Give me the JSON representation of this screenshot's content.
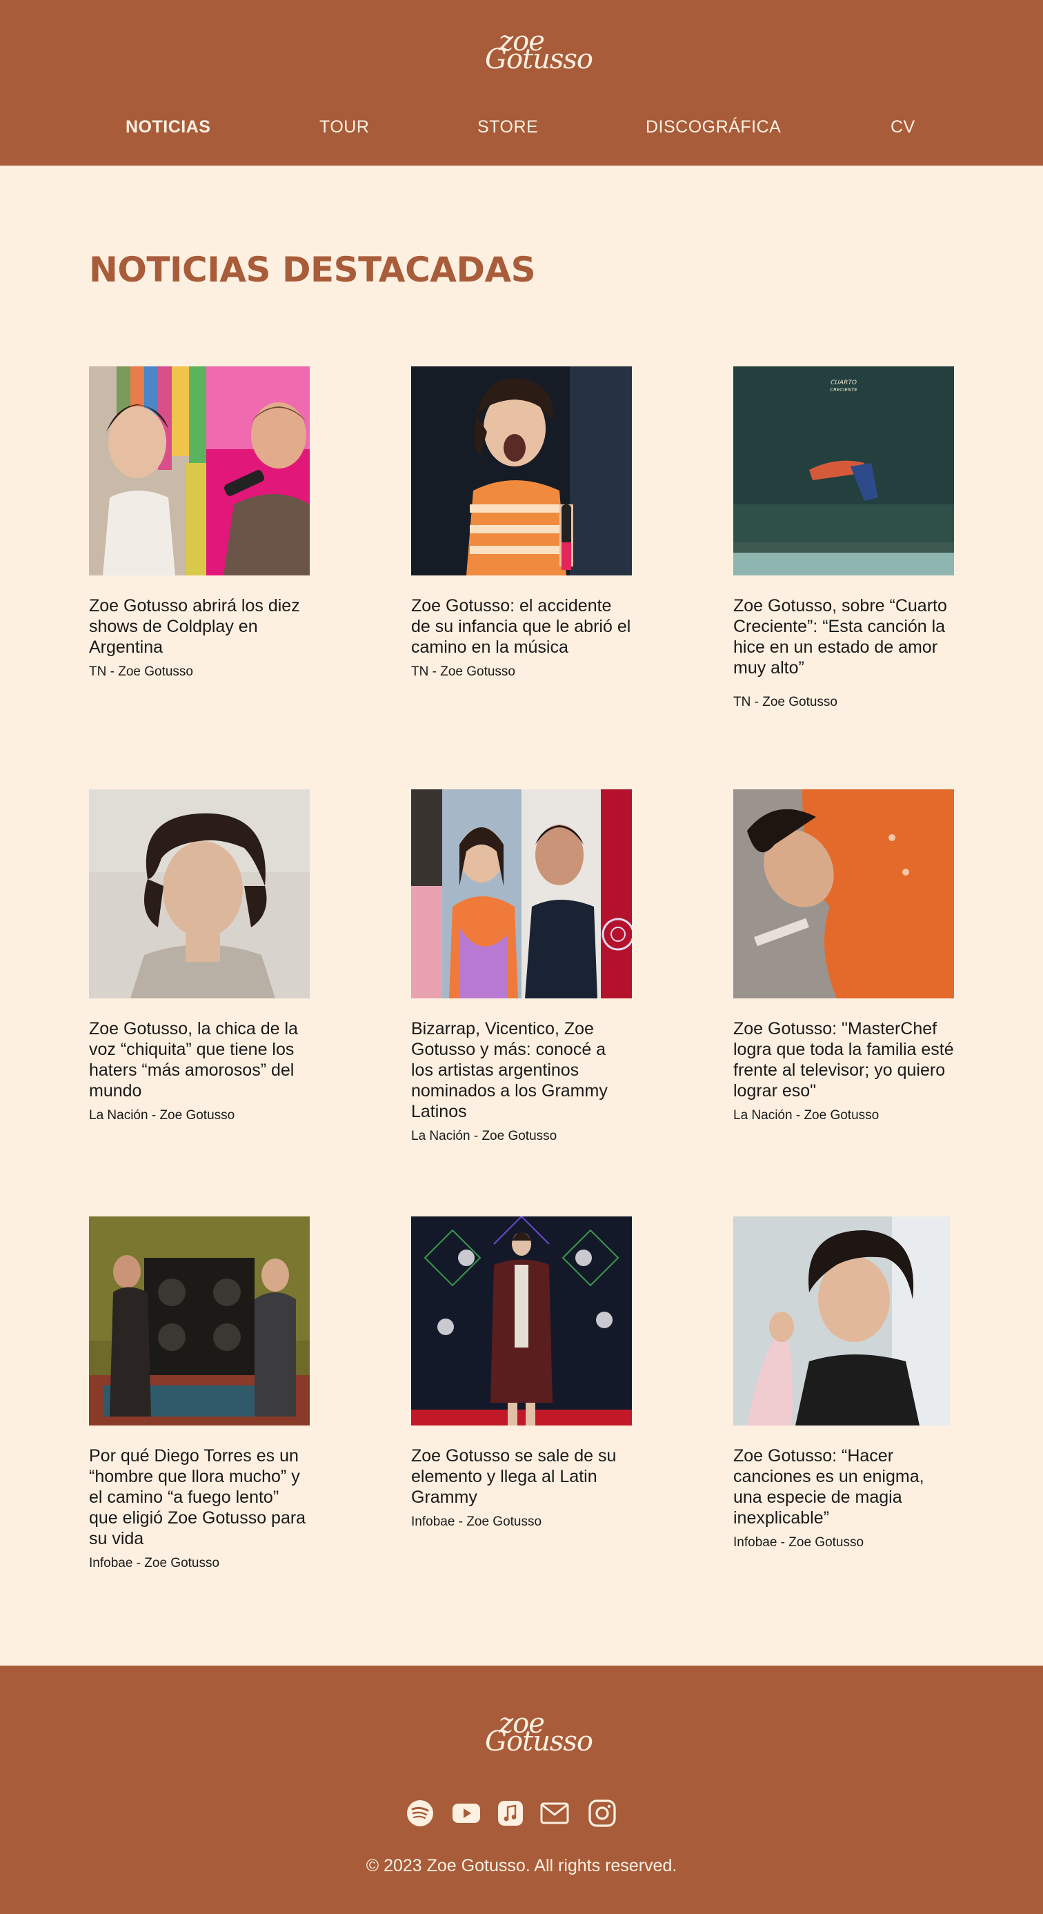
{
  "brand": {
    "logo_line1": "zoe",
    "logo_line2": "Gotusso",
    "header_color": "#a85c3a",
    "background_color": "#fdf0e1"
  },
  "nav": {
    "items": [
      {
        "label": "NOTICIAS",
        "active": true
      },
      {
        "label": "TOUR",
        "active": false
      },
      {
        "label": "STORE",
        "active": false
      },
      {
        "label": "DISCOGRÁFICA",
        "active": false
      },
      {
        "label": "CV",
        "active": false
      }
    ]
  },
  "main": {
    "title": "NOTICIAS DESTACADAS",
    "articles": [
      {
        "title": "Zoe Gotusso abrirá los diez shows de Coldplay en Argentina",
        "source": "TN - Zoe Gotusso",
        "image": "photo-zoe-and-coldplay-singer"
      },
      {
        "title": "Zoe Gotusso: el accidente de su infancia que le abrió el camino en la música",
        "source": "TN - Zoe Gotusso",
        "image": "photo-zoe-singing-on-stage"
      },
      {
        "title": "Zoe Gotusso, sobre “Cuarto Creciente”: “Esta canción la hice en un estado de amor muy alto”",
        "source": "TN - Zoe Gotusso",
        "image": "cuarto-creciente-cover"
      },
      {
        "title": "Zoe Gotusso, la chica de la voz “chiquita” que tiene los haters “más amorosos” del mundo",
        "source": "La Nación - Zoe Gotusso",
        "image": "portrait-zoe-curly-hair"
      },
      {
        "title": "Bizarrap, Vicentico, Zoe Gotusso y más: conocé a los artistas argentinos nominados a los Grammy Latinos",
        "source": "La Nación - Zoe Gotusso",
        "image": "collage-grammy-nominees"
      },
      {
        "title": "Zoe Gotusso: \"MasterChef logra que toda la familia esté frente al televisor; yo quiero lograr eso\"",
        "source": "La Nación - Zoe Gotusso",
        "image": "photo-zoe-orange-shirt-lying"
      },
      {
        "title": "Por qué Diego Torres es un “hombre que llora mucho” y el camino “a fuego lento” que eligió Zoe Gotusso para su vida",
        "source": "Infobae - Zoe Gotusso",
        "image": "photo-interview-speakers"
      },
      {
        "title": "Zoe Gotusso se sale de su elemento y llega al Latin Grammy",
        "source": "Infobae - Zoe Gotusso",
        "image": "photo-zoe-latin-grammy-red-carpet"
      },
      {
        "title": "Zoe Gotusso: “Hacer canciones es un enigma, una especie de magia inexplicable”",
        "source": "Infobae - Zoe Gotusso",
        "image": "portrait-zoe-black-jacket"
      }
    ]
  },
  "footer": {
    "socials": [
      {
        "icon": "spotify-icon"
      },
      {
        "icon": "youtube-icon"
      },
      {
        "icon": "apple-music-icon"
      },
      {
        "icon": "email-icon"
      },
      {
        "icon": "instagram-icon"
      }
    ],
    "copyright": "© 2023 Zoe Gotusso. All rights reserved."
  }
}
